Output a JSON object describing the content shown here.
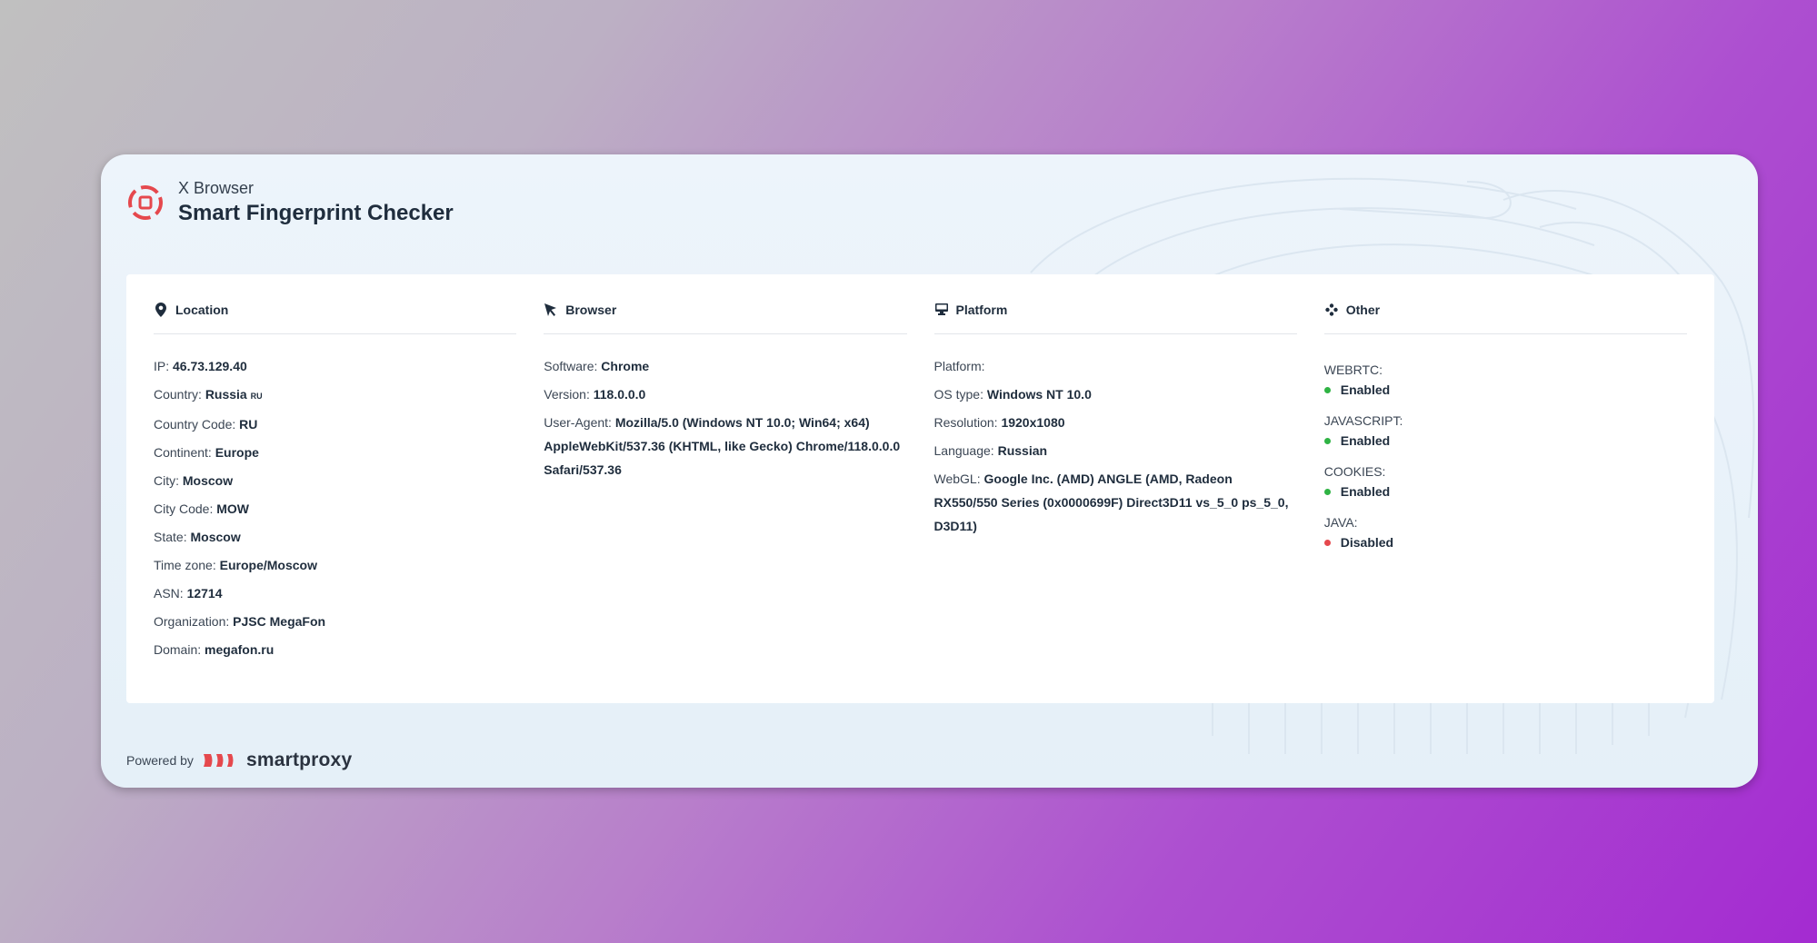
{
  "header": {
    "subtitle": "X Browser",
    "title": "Smart Fingerprint Checker"
  },
  "colors": {
    "accent": "#e5484d",
    "enabled": "#2fb344",
    "disabled": "#e5484d"
  },
  "location": {
    "heading": "Location",
    "icon": "map-pin-icon",
    "ip_label": "IP:",
    "ip": "46.73.129.40",
    "country_label": "Country:",
    "country": "Russia",
    "country_code_small": "RU",
    "country_code_label": "Country Code:",
    "country_code": "RU",
    "continent_label": "Continent:",
    "continent": "Europe",
    "city_label": "City:",
    "city": "Moscow",
    "city_code_label": "City Code:",
    "city_code": "MOW",
    "state_label": "State:",
    "state": "Moscow",
    "timezone_label": "Time zone:",
    "timezone": "Europe/Moscow",
    "asn_label": "ASN:",
    "asn": "12714",
    "org_label": "Organization:",
    "org": "PJSC MegaFon",
    "domain_label": "Domain:",
    "domain": "megafon.ru"
  },
  "browser": {
    "heading": "Browser",
    "icon": "cursor-icon",
    "software_label": "Software:",
    "software": "Chrome",
    "version_label": "Version:",
    "version": "118.0.0.0",
    "ua_label": "User-Agent:",
    "ua": "Mozilla/5.0 (Windows NT 10.0; Win64; x64) AppleWebKit/537.36 (KHTML, like Gecko) Chrome/118.0.0.0 Safari/537.36"
  },
  "platform": {
    "heading": "Platform",
    "icon": "monitor-icon",
    "platform_label": "Platform:",
    "platform": "",
    "os_label": "OS type:",
    "os": "Windows NT 10.0",
    "resolution_label": "Resolution:",
    "resolution": "1920x1080",
    "language_label": "Language:",
    "language": "Russian",
    "webgl_label": "WebGL:",
    "webgl": "Google Inc. (AMD) ANGLE (AMD, Radeon RX550/550 Series (0x0000699F) Direct3D11 vs_5_0 ps_5_0, D3D11)"
  },
  "other": {
    "heading": "Other",
    "icon": "dots-icon",
    "items": [
      {
        "label": "WEBRTC:",
        "status": "Enabled",
        "on": true
      },
      {
        "label": "JAVASCRIPT:",
        "status": "Enabled",
        "on": true
      },
      {
        "label": "COOKIES:",
        "status": "Enabled",
        "on": true
      },
      {
        "label": "JAVA:",
        "status": "Disabled",
        "on": false
      }
    ]
  },
  "footer": {
    "powered_by": "Powered by",
    "brand": "smartproxy"
  }
}
